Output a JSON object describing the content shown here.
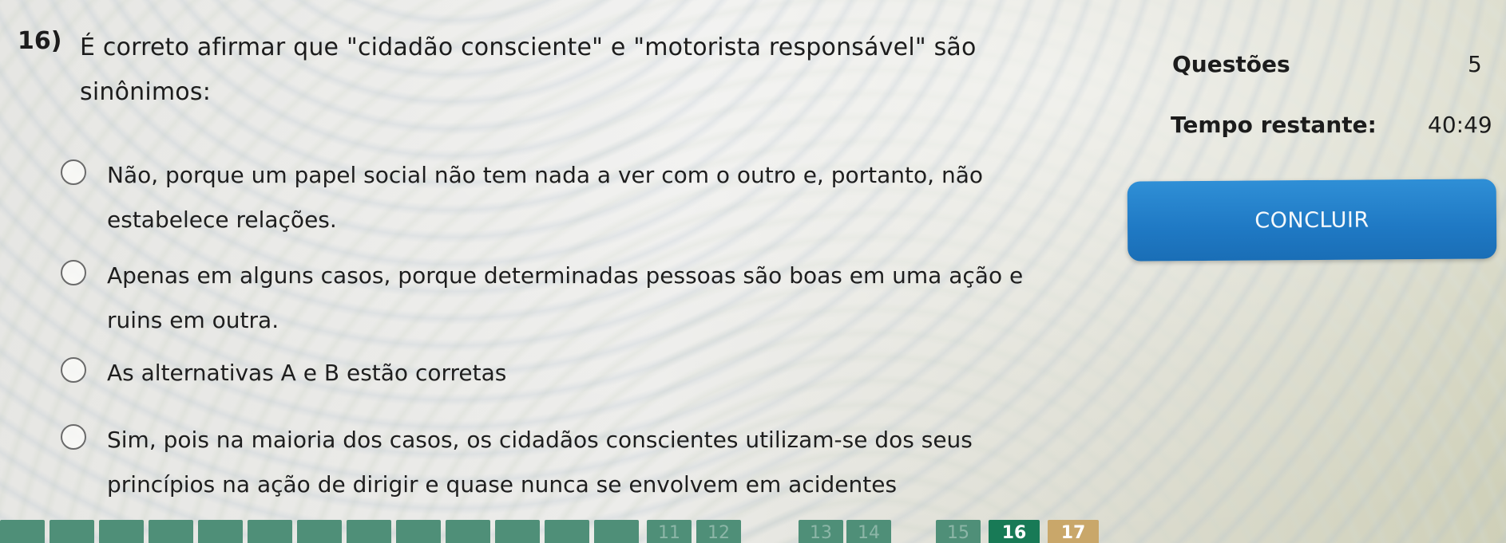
{
  "question": {
    "number": "16)",
    "text": "É correto afirmar que \"cidadão consciente\" e \"motorista responsável\" são sinônimos:"
  },
  "options": [
    {
      "text": "Não, porque um papel social não tem nada a ver com o outro e, portanto, não estabelece relações."
    },
    {
      "text": "Apenas em alguns casos, porque determinadas pessoas são boas em uma ação e ruins em outra."
    },
    {
      "text": "As alternativas A e B estão corretas"
    },
    {
      "text": "Sim, pois na maioria dos casos, os cidadãos conscientes utilizam-se dos seus princípios na ação de dirigir e quase nunca se envolvem em acidentes"
    }
  ],
  "sidebar": {
    "questoes_label": "Questões",
    "questoes_value": "5",
    "tempo_label": "Tempo restante:",
    "tempo_value": "40:49",
    "concluir_label": "CONCLUIR",
    "accent": "#1f7fc8"
  },
  "pager": {
    "items": [
      "11",
      "12",
      "13",
      "14",
      "15",
      "16",
      "17"
    ],
    "current": "16",
    "next": "17",
    "current_color": "#187a56",
    "next_color": "#c9a76a"
  }
}
